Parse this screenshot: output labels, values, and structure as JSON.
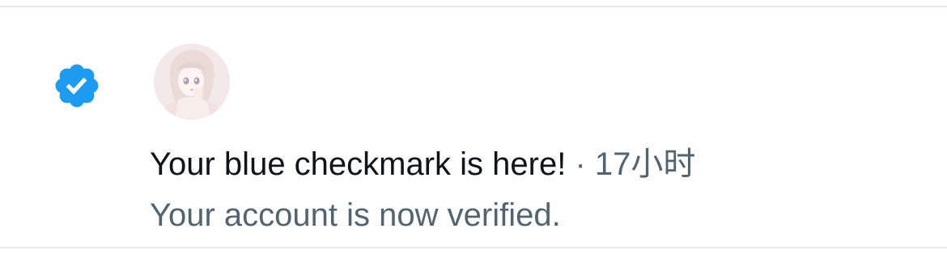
{
  "notification": {
    "icon": "verified-badge-icon",
    "accent_color": "#1d9bf0",
    "avatar_alt": "user avatar",
    "title": "Your blue checkmark is here!",
    "separator": " · ",
    "time": "17小时",
    "subtitle": "Your account is now verified."
  }
}
